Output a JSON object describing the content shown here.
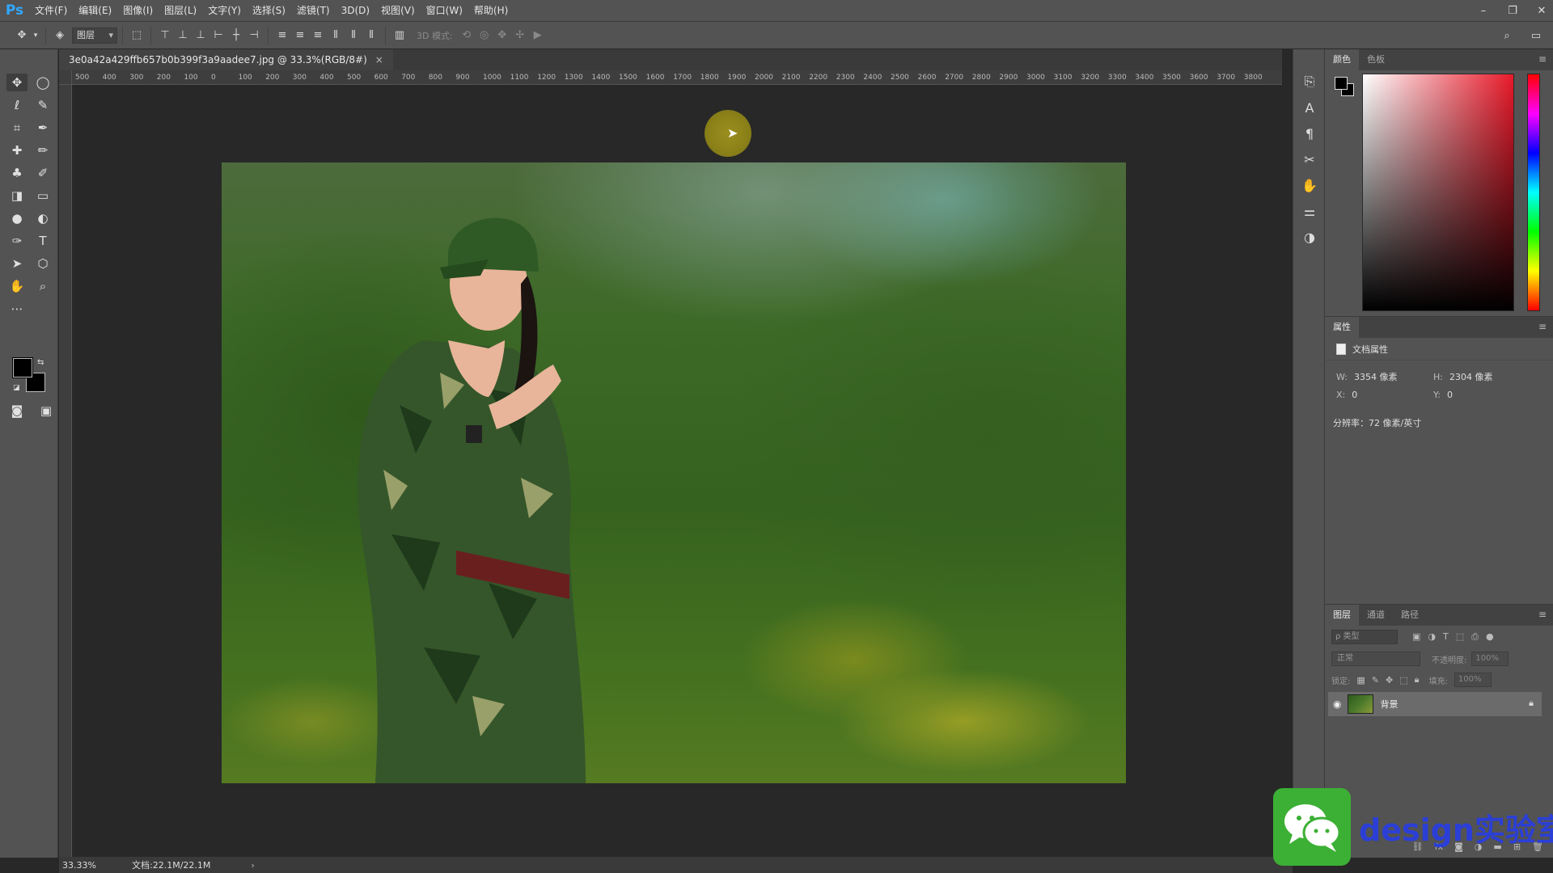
{
  "app": {
    "logo": "Ps"
  },
  "menu": [
    "文件(F)",
    "编辑(E)",
    "图像(I)",
    "图层(L)",
    "文字(Y)",
    "选择(S)",
    "滤镜(T)",
    "3D(D)",
    "视图(V)",
    "窗口(W)",
    "帮助(H)"
  ],
  "window_controls": {
    "minimize": "–",
    "restore": "❐",
    "close": "✕"
  },
  "options": {
    "auto_select": "图层",
    "mode_3d": "3D 模式:"
  },
  "document": {
    "tab_title": "3e0a42a429ffb657b0b399f3a9aadee7.jpg @ 33.3%(RGB/8#)",
    "close": "×"
  },
  "ruler_ticks": [
    "500",
    "400",
    "300",
    "200",
    "100",
    "0",
    "100",
    "200",
    "300",
    "400",
    "500",
    "600",
    "700",
    "800",
    "900",
    "1000",
    "1100",
    "1200",
    "1300",
    "1400",
    "1500",
    "1600",
    "1700",
    "1800",
    "1900",
    "2000",
    "2100",
    "2200",
    "2300",
    "2400",
    "2500",
    "2600",
    "2700",
    "2800",
    "2900",
    "3000",
    "3100",
    "3200",
    "3300",
    "3400",
    "3500",
    "3600",
    "3700",
    "3800"
  ],
  "color_panel": {
    "tabs": [
      "颜色",
      "色板"
    ],
    "fg_color": "#000000",
    "bg_color": "#000000"
  },
  "properties_panel": {
    "tab": "属性",
    "section": "文档属性",
    "w_label": "W:",
    "w_value": "3354 像素",
    "h_label": "H:",
    "h_value": "2304 像素",
    "x_label": "X:",
    "x_value": "0",
    "y_label": "Y:",
    "y_value": "0",
    "resolution": "分辨率：72 像素/英寸"
  },
  "layers_panel": {
    "tabs": [
      "图层",
      "通道",
      "路径"
    ],
    "filter_placeholder": "ρ 类型",
    "blend_mode": "正常",
    "opacity_label": "不透明度:",
    "opacity_value": "100%",
    "lock_label": "锁定:",
    "fill_label": "填充:",
    "fill_value": "100%",
    "layer_name": "背景"
  },
  "status": {
    "zoom": "33.33%",
    "doc_size": "文档:22.1M/22.1M",
    "arrow": "›"
  },
  "watermark": {
    "text": "design实验室"
  }
}
